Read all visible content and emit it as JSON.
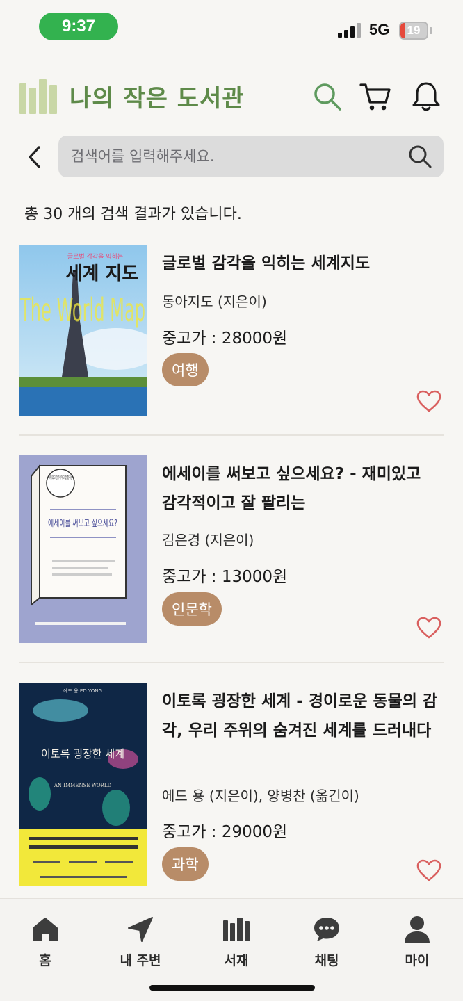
{
  "status_bar": {
    "time": "9:37",
    "network": "5G",
    "battery": "19",
    "battery_fraction": 0.19
  },
  "header": {
    "title": "나의 작은 도서관",
    "icons": [
      "library-books-icon",
      "search-icon",
      "cart-icon",
      "bell-icon"
    ]
  },
  "search": {
    "placeholder": "검색어를 입력해주세요."
  },
  "results": {
    "summary": "총 30 개의 검색 결과가 있습니다."
  },
  "books": [
    {
      "title": "글로벌 감각을 익히는 세계지도",
      "author": "동아지도 (지은이)",
      "price": "중고가 : 28000원",
      "category": "여행",
      "cover": {
        "subtitle": "글로벌 감각을 익히는",
        "title": "세계 지도",
        "overlay": "The World Map"
      }
    },
    {
      "title": "에세이를 써보고 싶으세요? - 재미있고 감각적이고 잘 팔리는",
      "author": "김은경 (지은이)",
      "price": "중고가 : 13000원",
      "category": "인문학",
      "cover": {
        "badge": "재미있고 감각적이고 잘 팔리는",
        "title": "에세이를 써보고 싶으세요?"
      }
    },
    {
      "title": "이토록 굉장한 세계 - 경이로운 동물의 감각, 우리 주위의 숨겨진 세계를 드러내다",
      "author": "에드 용 (지은이), 양병찬 (옮긴이)",
      "price": "중고가 : 29000원",
      "category": "과학",
      "cover": {
        "author": "에드 용 ED YONG",
        "title": "이토록 굉장한 세계",
        "english": "AN IMMENSE WORLD"
      }
    }
  ],
  "nav": [
    {
      "label": "홈",
      "icon": "home-icon"
    },
    {
      "label": "내 주변",
      "icon": "location-arrow-icon"
    },
    {
      "label": "서재",
      "icon": "bookshelf-icon"
    },
    {
      "label": "채팅",
      "icon": "chat-bubble-icon"
    },
    {
      "label": "마이",
      "icon": "user-icon"
    }
  ],
  "colors": {
    "brand_green": "#5e8a49",
    "logo_green": "#c9d7a6",
    "tag_brown": "#b88c68",
    "heart_red": "#d9605f",
    "time_pill_green": "#33b24f"
  }
}
